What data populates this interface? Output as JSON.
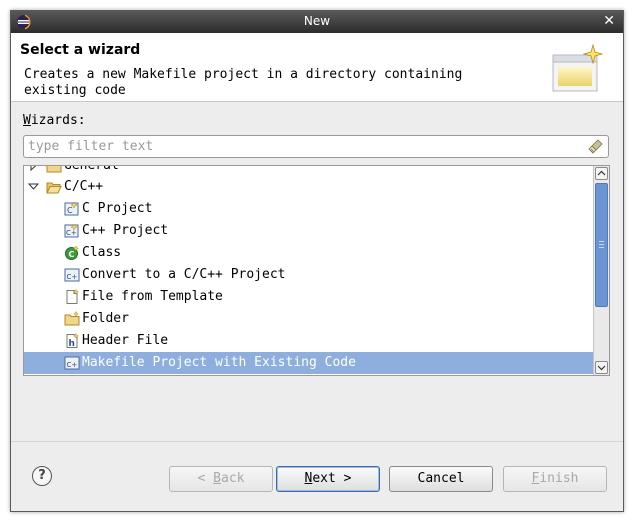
{
  "window": {
    "title": "New",
    "close_icon": "close-icon"
  },
  "header": {
    "title": "Select a wizard",
    "description": "Creates a new Makefile project in a directory containing existing code"
  },
  "wizards_label": {
    "mnemonic": "W",
    "rest": "izards:"
  },
  "filter": {
    "value": "",
    "placeholder": "type filter text"
  },
  "tree": {
    "items": [
      {
        "label": "General",
        "icon": "folder-icon",
        "level": 0,
        "expanded": false
      },
      {
        "label": "C/C++",
        "icon": "folder-open-icon",
        "level": 0,
        "expanded": true
      },
      {
        "label": "C Project",
        "icon": "c-project-icon",
        "level": 1
      },
      {
        "label": "C++ Project",
        "icon": "cpp-project-icon",
        "level": 1
      },
      {
        "label": "Class",
        "icon": "class-icon",
        "level": 1
      },
      {
        "label": "Convert to a C/C++ Project",
        "icon": "convert-icon",
        "level": 1
      },
      {
        "label": "File from Template",
        "icon": "file-icon",
        "level": 1
      },
      {
        "label": "Folder",
        "icon": "folder-icon",
        "level": 1
      },
      {
        "label": "Header File",
        "icon": "header-file-icon",
        "level": 1
      },
      {
        "label": "Makefile Project with Existing Code",
        "icon": "makefile-project-icon",
        "level": 1,
        "selected": true
      }
    ]
  },
  "buttons": {
    "help": "?",
    "back": {
      "mnemonic": "B",
      "pre": "< ",
      "rest": "ack",
      "enabled": false
    },
    "next": {
      "mnemonic": "N",
      "rest": "ext >",
      "enabled": true
    },
    "cancel": {
      "label": "Cancel",
      "enabled": true
    },
    "finish": {
      "mnemonic": "F",
      "rest": "inish",
      "enabled": false
    }
  },
  "colors": {
    "selection": "#8eaedd",
    "titlebar": "#3a3a3a",
    "scroll_thumb": "#6b95d2"
  }
}
